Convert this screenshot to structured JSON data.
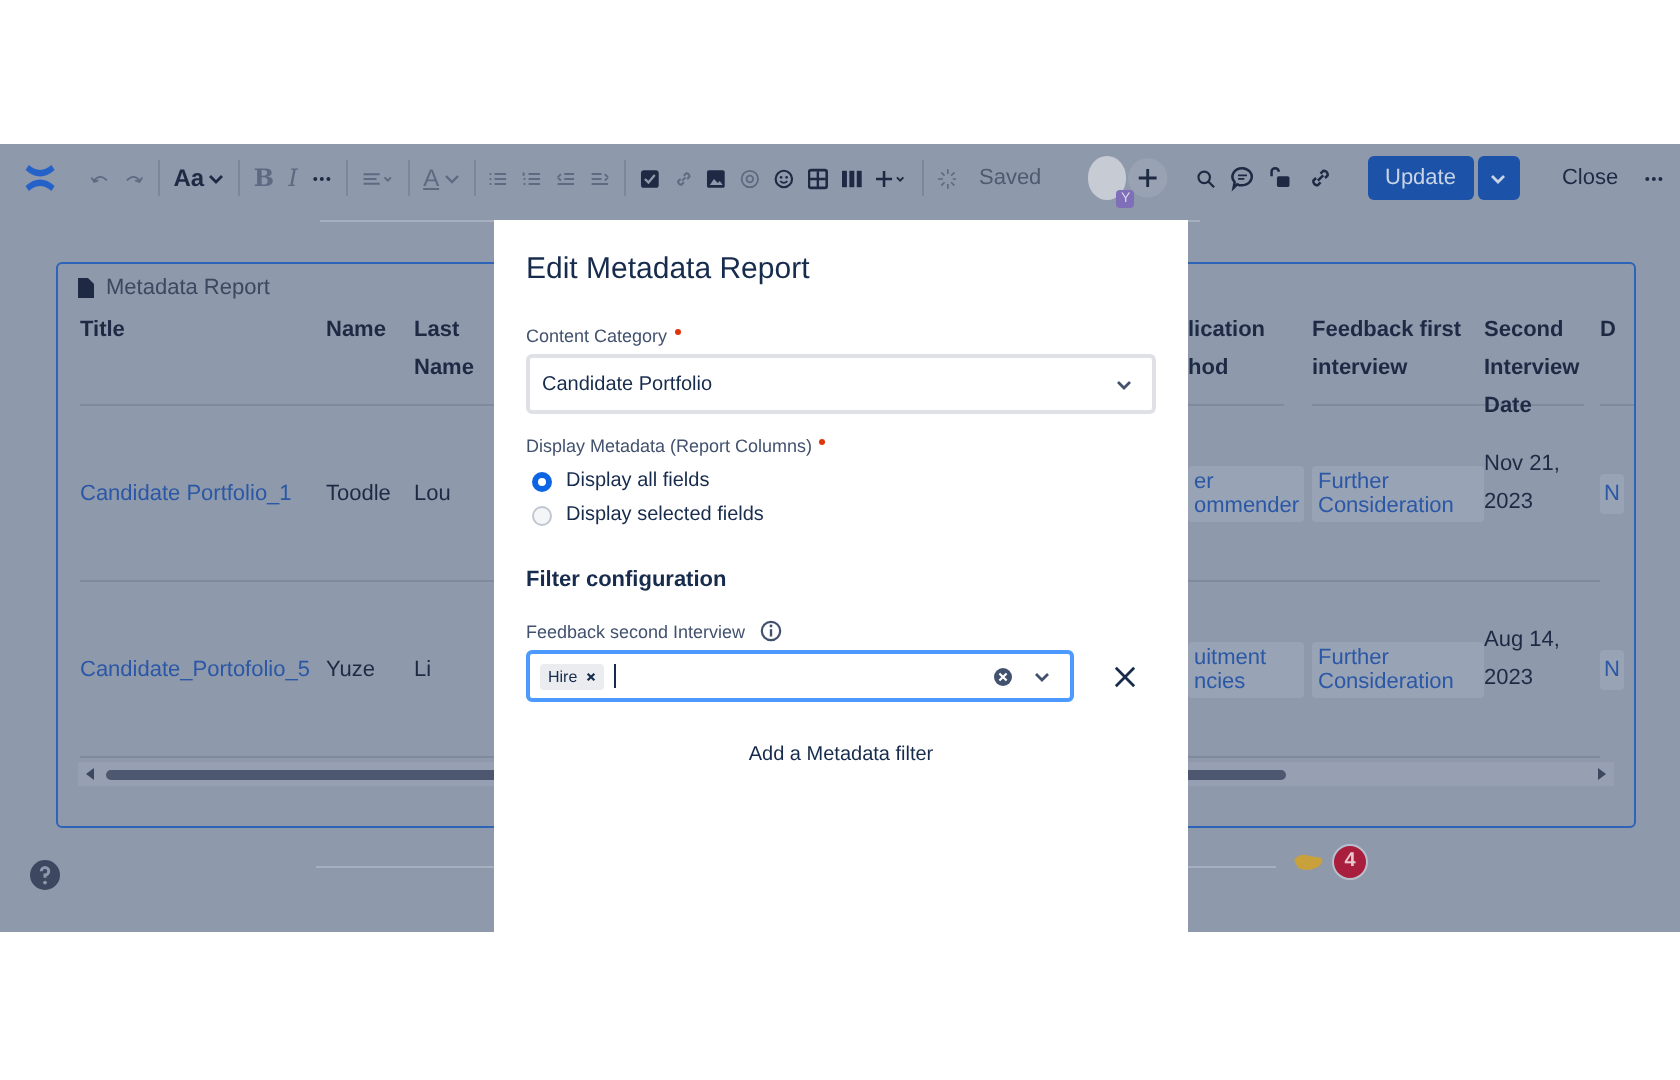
{
  "toolbar": {
    "text_style": "Aa",
    "bold": "B",
    "italic": "I",
    "text_color": "A",
    "saved": "Saved",
    "avatar_badge": "Y",
    "update": "Update",
    "close": "Close"
  },
  "report": {
    "title": "Metadata Report",
    "columns": [
      "Title",
      "Name",
      "Last Name",
      "lication hod",
      "Feedback first interview",
      "Second Interview Date",
      "D"
    ],
    "rows": [
      {
        "title": "Candidate Portfolio_1",
        "name": "Toodle",
        "last_name": "Lou",
        "column_4": "er ommender",
        "feedback_first": "Further Consideration",
        "second_date": "Nov 21, 2023",
        "column_7": "N"
      },
      {
        "title": "Candidate_Portofolio_5",
        "name": "Yuze",
        "last_name": "Li",
        "column_4": "uitment ncies",
        "feedback_first": "Further Consideration",
        "second_date": "Aug 14, 2023",
        "column_7": "N"
      }
    ]
  },
  "notification_count": "4",
  "dialog": {
    "title": "Edit Metadata Report",
    "content_category": {
      "label": "Content Category",
      "required": true,
      "value": "Candidate Portfolio"
    },
    "display_metadata": {
      "label": "Display Metadata (Report Columns)",
      "required": true,
      "options": [
        {
          "label": "Display all fields",
          "selected": true
        },
        {
          "label": "Display selected fields",
          "selected": false
        }
      ]
    },
    "filter_heading": "Filter configuration",
    "filter": {
      "label": "Feedback second Interview",
      "tags": [
        "Hire"
      ]
    },
    "add_filter": "Add a Metadata filter"
  }
}
